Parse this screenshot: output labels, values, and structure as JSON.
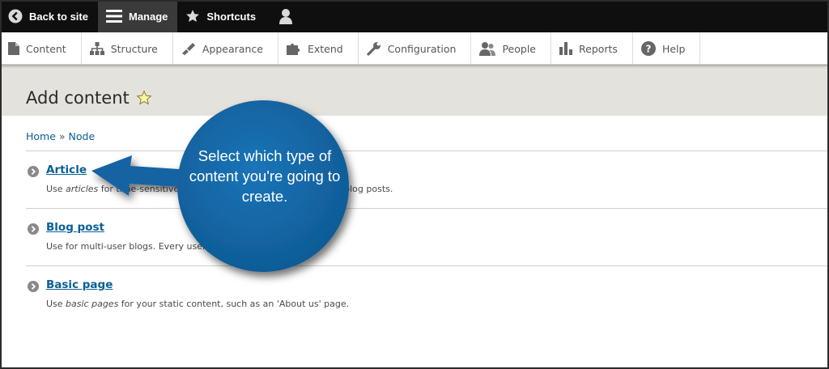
{
  "toolbar": {
    "back_label": "Back to site",
    "manage_label": "Manage",
    "shortcuts_label": "Shortcuts",
    "user_icon": "user-icon"
  },
  "tray": {
    "items": [
      {
        "label": "Content",
        "icon": "content-icon"
      },
      {
        "label": "Structure",
        "icon": "structure-icon"
      },
      {
        "label": "Appearance",
        "icon": "appearance-icon"
      },
      {
        "label": "Extend",
        "icon": "extend-icon"
      },
      {
        "label": "Configuration",
        "icon": "configuration-icon"
      },
      {
        "label": "People",
        "icon": "people-icon"
      },
      {
        "label": "Reports",
        "icon": "reports-icon"
      },
      {
        "label": "Help",
        "icon": "help-icon"
      }
    ]
  },
  "page": {
    "title": "Add content"
  },
  "breadcrumb": {
    "home": "Home",
    "separator": "»",
    "node": "Node"
  },
  "content_types": [
    {
      "title": "Article",
      "desc_prefix": "Use ",
      "desc_em": "articles",
      "desc_rest": " for time-sensitive content like news, press releases or blog posts."
    },
    {
      "title": "Blog post",
      "desc_prefix": "Use for multi-user blogs. Every user gets a personal blog.",
      "desc_em": "",
      "desc_rest": ""
    },
    {
      "title": "Basic page",
      "desc_prefix": "Use ",
      "desc_em": "basic pages",
      "desc_rest": " for your static content, such as an 'About us' page."
    }
  ],
  "callout": {
    "text": "Select which type of content you're going to create.",
    "color": "#1264a3"
  },
  "colors": {
    "toolbar_bg": "#0f0f0f",
    "link": "#0a5f96",
    "header_bg": "#e4e2dc"
  }
}
